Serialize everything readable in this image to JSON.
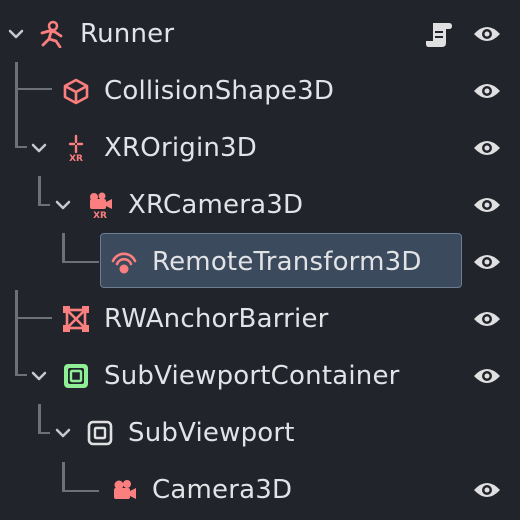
{
  "colors": {
    "background": "#21252b",
    "text": "#e1e3e6",
    "guide": "#6d7078",
    "node3d": "#fc7f7f",
    "control": "#8eef97",
    "viewport": "#e0e0e0",
    "selection": "#3b4a5c",
    "selection_border": "#6b7d92"
  },
  "tree": {
    "nodes": [
      {
        "label": "Runner",
        "icon": "runner-icon",
        "expanded": true,
        "has_script": true,
        "visible": true
      },
      {
        "label": "CollisionShape3D",
        "icon": "collision-shape-icon",
        "visible": true
      },
      {
        "label": "XROrigin3D",
        "icon": "xr-origin-icon",
        "expanded": true,
        "visible": true
      },
      {
        "label": "XRCamera3D",
        "icon": "xr-camera-icon",
        "expanded": true,
        "visible": true
      },
      {
        "label": "RemoteTransform3D",
        "icon": "remote-transform-icon",
        "selected": true,
        "visible": true
      },
      {
        "label": "RWAnchorBarrier",
        "icon": "anchor-barrier-icon",
        "visible": true
      },
      {
        "label": "SubViewportContainer",
        "icon": "subviewport-container-icon",
        "expanded": true,
        "visible": true
      },
      {
        "label": "SubViewport",
        "icon": "subviewport-icon",
        "expanded": true
      },
      {
        "label": "Camera3D",
        "icon": "camera-icon",
        "visible": true
      }
    ]
  }
}
